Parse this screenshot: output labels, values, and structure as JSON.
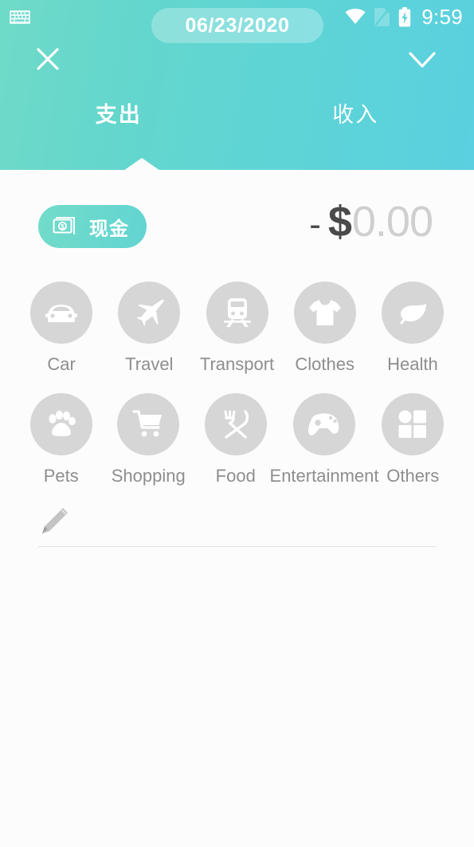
{
  "statusbar": {
    "time": "9:59",
    "icons": [
      "keyboard-icon",
      "wifi-icon",
      "sim-card-icon",
      "battery-charging-icon"
    ]
  },
  "header": {
    "close_label": "close-icon",
    "confirm_label": "check-icon",
    "date": "06/23/2020",
    "tabs": [
      {
        "label": "支出",
        "active": true
      },
      {
        "label": "收入",
        "active": false
      }
    ]
  },
  "entry": {
    "account": {
      "label": "现金",
      "icon": "cash-note-icon"
    },
    "amount": {
      "sign": "-",
      "currency": "$",
      "value": "0.00"
    }
  },
  "categories": {
    "row1": [
      {
        "label": "Car",
        "icon": "car-icon"
      },
      {
        "label": "Travel",
        "icon": "airplane-icon"
      },
      {
        "label": "Transport",
        "icon": "train-icon"
      },
      {
        "label": "Clothes",
        "icon": "tshirt-icon"
      },
      {
        "label": "Health",
        "icon": "leaf-icon"
      }
    ],
    "row2": [
      {
        "label": "Pets",
        "icon": "paw-icon"
      },
      {
        "label": "Shopping",
        "icon": "shopping-cart-icon"
      },
      {
        "label": "Food",
        "icon": "fork-knife-icon"
      },
      {
        "label": "Entertainment",
        "icon": "game-controller-icon"
      },
      {
        "label": "Others",
        "icon": "grid-icon"
      }
    ]
  },
  "note": {
    "value": "",
    "placeholder": "",
    "icon": "pencil-icon"
  },
  "colors": {
    "header_gradient_start": "#6fdac8",
    "header_gradient_end": "#5ad0e0",
    "chip_gradient_start": "#72dcc9",
    "chip_gradient_end": "#62d4d2",
    "background": "#fcfcfc",
    "category_circle": "#d6d6d6",
    "category_label": "#8e8e8e",
    "amount_active": "#4a4a4a",
    "amount_placeholder": "#cfcfcf"
  }
}
